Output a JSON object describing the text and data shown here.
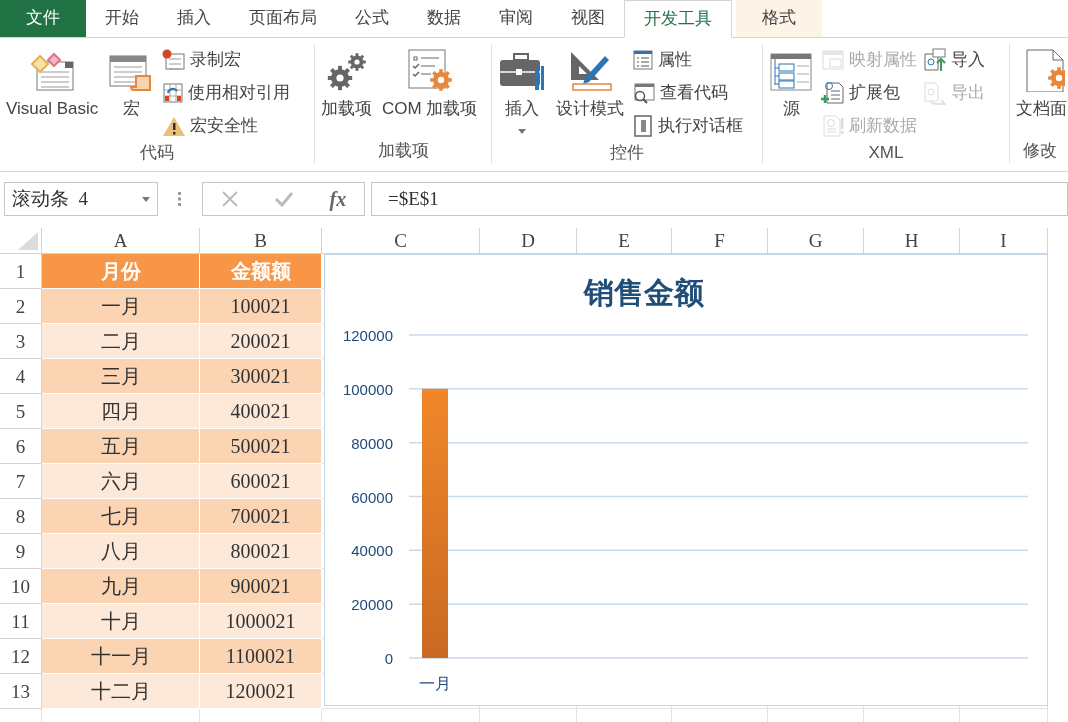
{
  "tabs": [
    {
      "label": "文件",
      "kind": "file",
      "selected": false
    },
    {
      "label": "开始",
      "kind": "normal",
      "selected": false
    },
    {
      "label": "插入",
      "kind": "normal",
      "selected": false
    },
    {
      "label": "页面布局",
      "kind": "normal",
      "selected": false
    },
    {
      "label": "公式",
      "kind": "normal",
      "selected": false
    },
    {
      "label": "数据",
      "kind": "normal",
      "selected": false
    },
    {
      "label": "审阅",
      "kind": "normal",
      "selected": false
    },
    {
      "label": "视图",
      "kind": "normal",
      "selected": false
    },
    {
      "label": "开发工具",
      "kind": "normal",
      "selected": true
    },
    {
      "label": "格式",
      "kind": "context",
      "selected": false
    }
  ],
  "ribbon_groups": [
    {
      "label": "代码",
      "columns": [
        {
          "kind": "large",
          "label": "Visual Basic",
          "disabled": false
        },
        {
          "kind": "large",
          "label": "宏",
          "disabled": false
        },
        {
          "kind": "stack",
          "items": [
            {
              "label": "录制宏",
              "disabled": false
            },
            {
              "label": "使用相对引用",
              "disabled": false
            },
            {
              "label": "宏安全性",
              "disabled": false
            }
          ]
        }
      ]
    },
    {
      "label": "加载项",
      "columns": [
        {
          "kind": "large",
          "label": "加载项",
          "disabled": false
        },
        {
          "kind": "large",
          "label": "COM 加载项",
          "disabled": false
        }
      ]
    },
    {
      "label": "控件",
      "columns": [
        {
          "kind": "large",
          "label": "插入",
          "dropdown": true,
          "disabled": false
        },
        {
          "kind": "large",
          "label": "设计模式",
          "disabled": false
        },
        {
          "kind": "stack",
          "items": [
            {
              "label": "属性",
              "disabled": false
            },
            {
              "label": "查看代码",
              "disabled": false
            },
            {
              "label": "执行对话框",
              "disabled": false
            }
          ]
        }
      ]
    },
    {
      "label": "XML",
      "columns": [
        {
          "kind": "large",
          "label": "源",
          "disabled": false
        },
        {
          "kind": "stack",
          "items": [
            {
              "label": "映射属性",
              "disabled": true
            },
            {
              "label": "扩展包",
              "disabled": false
            },
            {
              "label": "刷新数据",
              "disabled": true
            }
          ]
        },
        {
          "kind": "stack",
          "items": [
            {
              "label": "导入",
              "disabled": false
            },
            {
              "label": "导出",
              "disabled": true
            }
          ]
        }
      ]
    },
    {
      "label": "修改",
      "columns": [
        {
          "kind": "large",
          "label": "文档面",
          "disabled": false
        }
      ]
    }
  ],
  "formula_bar": {
    "name_box": "滚动条  4",
    "function_label": "fx",
    "formula": "=$E$1"
  },
  "sheet": {
    "columns": [
      "A",
      "B",
      "C",
      "D",
      "E",
      "F",
      "G",
      "H",
      "I"
    ],
    "rows": [
      {
        "number": "1",
        "kind": "header",
        "cells": [
          "月份",
          "金额额"
        ]
      },
      {
        "number": "2",
        "kind": "data",
        "cells": [
          "一月",
          "100021"
        ]
      },
      {
        "number": "3",
        "kind": "data",
        "cells": [
          "二月",
          "200021"
        ]
      },
      {
        "number": "4",
        "kind": "data",
        "cells": [
          "三月",
          "300021"
        ]
      },
      {
        "number": "5",
        "kind": "data",
        "cells": [
          "四月",
          "400021"
        ]
      },
      {
        "number": "6",
        "kind": "data",
        "cells": [
          "五月",
          "500021"
        ]
      },
      {
        "number": "7",
        "kind": "data",
        "cells": [
          "六月",
          "600021"
        ]
      },
      {
        "number": "8",
        "kind": "data",
        "cells": [
          "七月",
          "700021"
        ]
      },
      {
        "number": "9",
        "kind": "data",
        "cells": [
          "八月",
          "800021"
        ]
      },
      {
        "number": "10",
        "kind": "data",
        "cells": [
          "九月",
          "900021"
        ]
      },
      {
        "number": "11",
        "kind": "data",
        "cells": [
          "十月",
          "1000021"
        ]
      },
      {
        "number": "12",
        "kind": "data",
        "cells": [
          "十一月",
          "1100021"
        ]
      },
      {
        "number": "13",
        "kind": "data",
        "cells": [
          "十二月",
          "1200021"
        ]
      }
    ]
  },
  "chart": {
    "chart_data": {
      "type": "bar",
      "title": "销售金额",
      "categories": [
        "一月"
      ],
      "series": [
        {
          "color": "#f0872a",
          "values": [
            100000
          ]
        }
      ],
      "grid": true,
      "ylim": [
        0,
        120000
      ],
      "yticks": [
        0,
        20000,
        40000,
        60000,
        80000,
        100000,
        120000
      ]
    }
  }
}
